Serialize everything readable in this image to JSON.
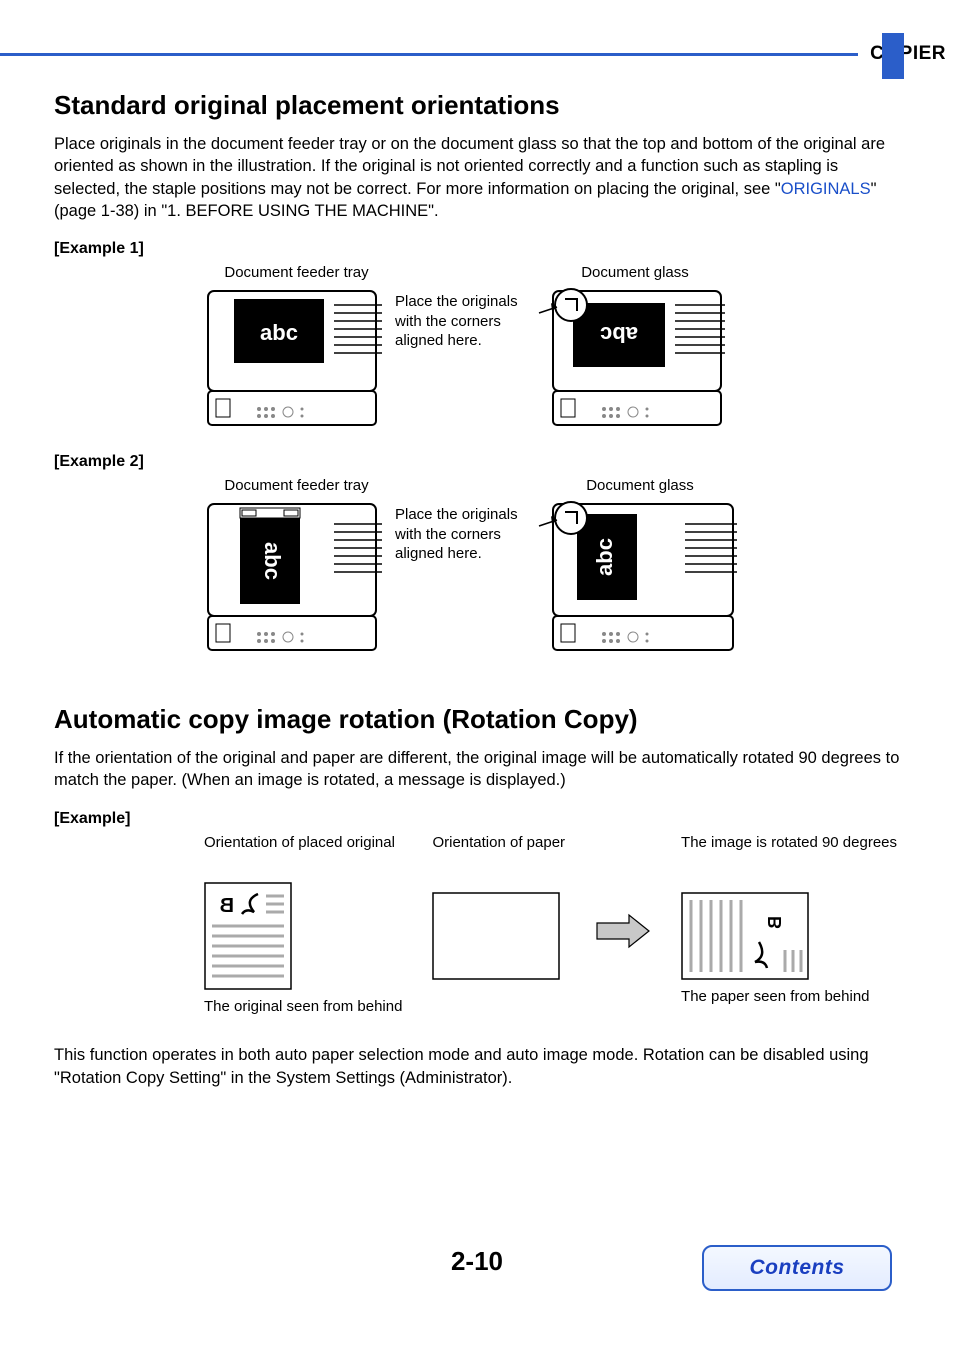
{
  "header": {
    "chapter": "COPIER"
  },
  "section1": {
    "title": "Standard original placement orientations",
    "intro_before_link": "Place originals in the document feeder tray or on the document glass so that the top and bottom of the original are oriented as shown in the illustration. If the original is not oriented correctly and a function such as stapling is selected, the staple positions may not be correct. For more information on placing the original, see \"",
    "link_text": "ORIGINALS",
    "intro_after_link": "\" (page 1-38) in \"1. BEFORE USING THE MACHINE\".",
    "example1_label": "[Example 1]",
    "example2_label": "[Example 2]",
    "feeder_label": "Document feeder tray",
    "glass_label": "Document glass",
    "note": "Place the originals with the corners aligned here.",
    "abc": "abc"
  },
  "section2": {
    "title": "Automatic copy image rotation (Rotation Copy)",
    "intro": "If the orientation of the original and paper are different, the original image will be automatically rotated 90 degrees to match the paper. (When an image is rotated, a message is displayed.)",
    "example_label": "[Example]",
    "col1_top": "Orientation of placed original",
    "col1_bot": "The original seen from behind",
    "col2_top": "Orientation of paper",
    "col3_top": "The image is rotated 90 degrees",
    "col3_bot": "The paper seen from behind",
    "foot": "This function operates in both auto paper selection mode and auto image mode. Rotation can be disabled using \"Rotation Copy Setting\" in the System Settings (Administrator)."
  },
  "footer": {
    "page_number": "2-10",
    "contents": "Contents"
  }
}
